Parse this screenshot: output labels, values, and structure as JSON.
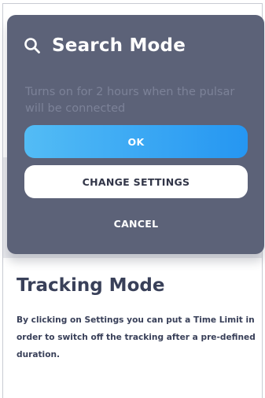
{
  "modal": {
    "icon": "search-icon",
    "title": "Search Mode",
    "description": "Turns on for 2 hours when the pulsar will be connected",
    "ok_label": "OK",
    "change_settings_label": "CHANGE SETTINGS",
    "cancel_label": "CANCEL"
  },
  "page": {
    "heading": "Tracking Mode",
    "body": "By clicking on Settings you can put a Time Limit in order to switch off the tracking after a pre-defined duration."
  },
  "colors": {
    "modal_background": "#5c6278",
    "primary_gradient_start": "#53bcf5",
    "primary_gradient_end": "#2596f2",
    "heading_text": "#394059",
    "muted_text": "#7c8298"
  }
}
